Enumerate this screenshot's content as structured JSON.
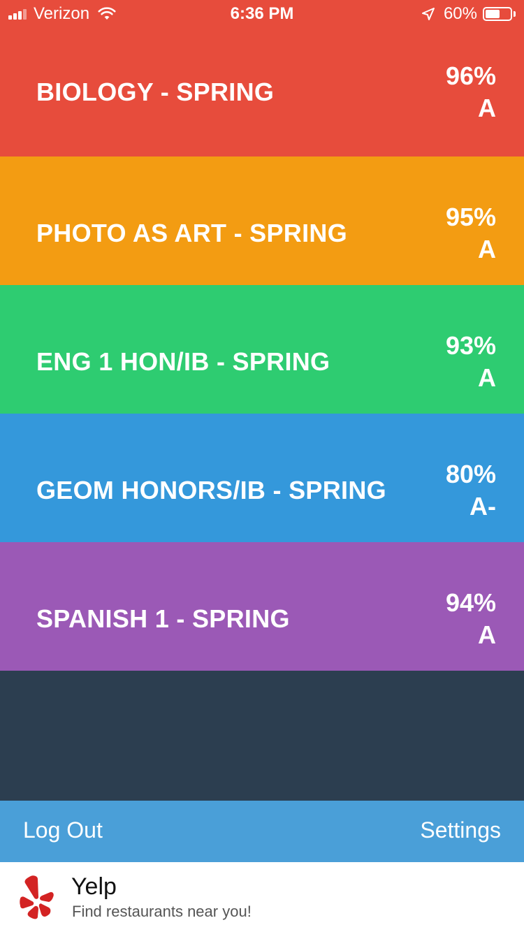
{
  "status_bar": {
    "carrier": "Verizon",
    "time": "6:36 PM",
    "battery_percent": "60%",
    "battery_level": 0.6,
    "signal_bars_filled": 3,
    "signal_bars_total": 4,
    "icons": [
      "signal-icon",
      "wifi-icon",
      "location-arrow-icon",
      "battery-icon"
    ]
  },
  "courses": [
    {
      "name": "BIOLOGY - SPRING",
      "percent": "96%",
      "letter": "A",
      "color": "#e74c3c"
    },
    {
      "name": "PHOTO AS ART - SPRING",
      "percent": "95%",
      "letter": "A",
      "color": "#f39c12"
    },
    {
      "name": "ENG 1 HON/IB - SPRING",
      "percent": "93%",
      "letter": "A",
      "color": "#2ecc71"
    },
    {
      "name": "GEOM HONORS/IB - SPRING",
      "percent": "80%",
      "letter": "A-",
      "color": "#3498db"
    },
    {
      "name": "SPANISH 1 - SPRING",
      "percent": "94%",
      "letter": "A",
      "color": "#9b59b6"
    }
  ],
  "colors": {
    "background": "#2c3e50",
    "action_bar": "#4a9fd8",
    "yelp_red": "#d32323"
  },
  "action_bar": {
    "logout_label": "Log Out",
    "settings_label": "Settings"
  },
  "ad": {
    "title": "Yelp",
    "subtitle": "Find restaurants near you!",
    "icon": "yelp-logo-icon"
  }
}
